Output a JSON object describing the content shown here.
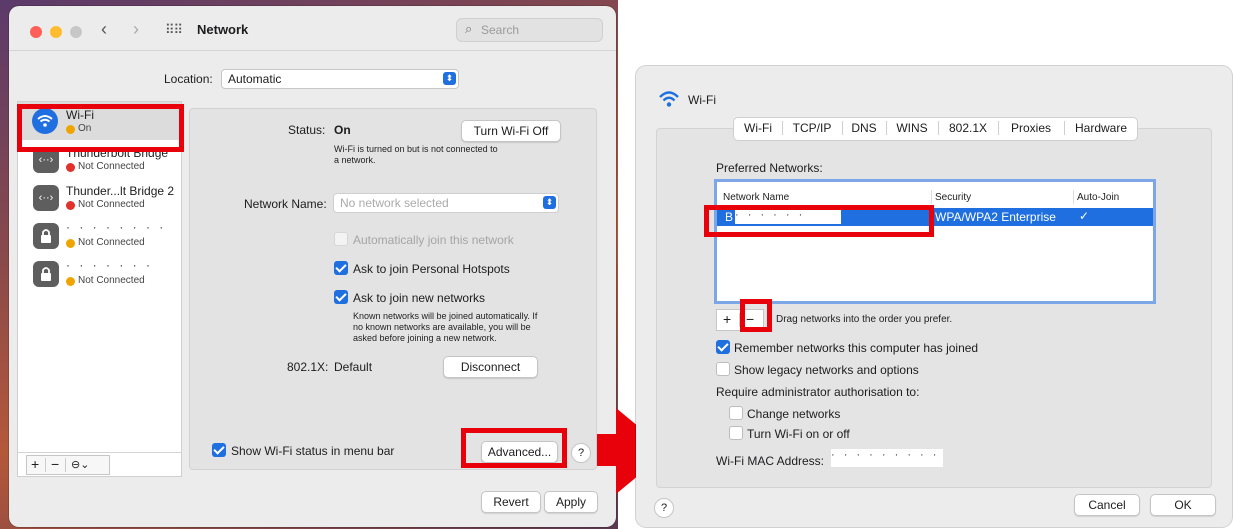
{
  "left": {
    "title": "Network",
    "search_placeholder": "Search",
    "location_label": "Location:",
    "location_value": "Automatic",
    "services": [
      {
        "name": "Wi-Fi",
        "status": "On",
        "status_color": "#f0a400"
      },
      {
        "name": "Thunderbolt Bridge",
        "status": "Not Connected",
        "status_color": "#e0312b"
      },
      {
        "name": "Thunder...lt Bridge 2",
        "status": "Not Connected",
        "status_color": "#e0312b"
      },
      {
        "name": "",
        "status": "Not Connected",
        "status_color": "#f0a400"
      },
      {
        "name": "",
        "status": "Not Connected",
        "status_color": "#f0a400"
      }
    ],
    "sidebar_buttons": {
      "add": "+",
      "remove": "−",
      "action": "⊖⌄"
    },
    "status_label": "Status:",
    "status_value": "On",
    "turn_off_button": "Turn Wi-Fi Off",
    "status_desc_1": "Wi-Fi is turned on but is not connected to",
    "status_desc_2": "a network.",
    "network_name_label": "Network Name:",
    "network_name_placeholder": "No network selected",
    "auto_join": "Automatically join this network",
    "ask_hotspots": "Ask to join Personal Hotspots",
    "ask_new": "Ask to join new networks",
    "ask_new_desc_1": "Known networks will be joined automatically. If",
    "ask_new_desc_2": "no known networks are available, you will be",
    "ask_new_desc_3": "asked before joining a new network.",
    "dot1x_label": "802.1X:",
    "dot1x_value": "Default",
    "disconnect_button": "Disconnect",
    "show_status": "Show Wi-Fi status in menu bar",
    "advanced_button": "Advanced...",
    "help": "?",
    "revert_button": "Revert",
    "apply_button": "Apply"
  },
  "right": {
    "title": "Wi-Fi",
    "tabs": [
      "Wi-Fi",
      "TCP/IP",
      "DNS",
      "WINS",
      "802.1X",
      "Proxies",
      "Hardware"
    ],
    "preferred_label": "Preferred Networks:",
    "columns": [
      "Network Name",
      "Security",
      "Auto-Join"
    ],
    "rows": [
      {
        "name": "B",
        "security": "WPA/WPA2 Enterprise",
        "auto_join": "✓"
      }
    ],
    "add": "+",
    "remove": "−",
    "drag_hint": "Drag networks into the order you prefer.",
    "remember": "Remember networks this computer has joined",
    "legacy": "Show legacy networks and options",
    "require_admin": "Require administrator authorisation to:",
    "change_networks": "Change networks",
    "turn_wifi": "Turn Wi-Fi on or off",
    "mac_label": "Wi-Fi MAC Address:",
    "help": "?",
    "cancel_button": "Cancel",
    "ok_button": "OK"
  },
  "colors": {
    "highlight_red": "#e8000b",
    "accent_blue": "#1f6fe0"
  }
}
